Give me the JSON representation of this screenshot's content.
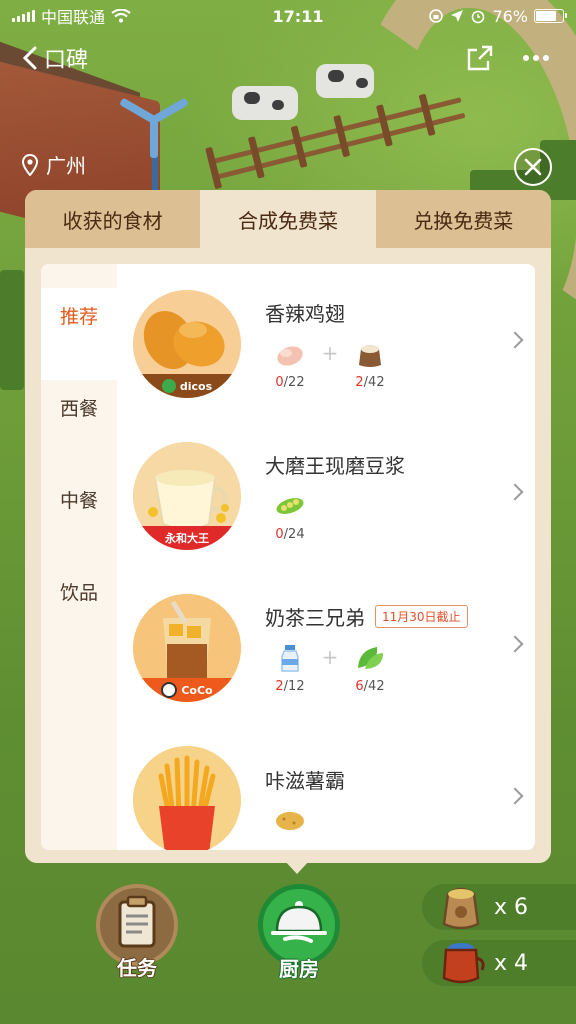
{
  "status_bar": {
    "carrier": "中国联通",
    "time": "17:11",
    "battery": "76%",
    "battery_level": 0.76
  },
  "nav": {
    "title": "口碑"
  },
  "location": "广州",
  "tabs": [
    "收获的食材",
    "合成免费菜",
    "兑换免费菜"
  ],
  "active_tab": 1,
  "categories": [
    "推荐",
    "西餐",
    "中餐",
    "饮品"
  ],
  "active_category": 0,
  "dishes": [
    {
      "name": "香辣鸡翅",
      "brand": "dicos",
      "deadline": "",
      "ingredients": [
        {
          "icon": "chicken-wing-icon",
          "have": "0",
          "need": "/22"
        },
        {
          "icon": "flour-sack-icon",
          "have": "2",
          "need": "/42"
        }
      ]
    },
    {
      "name": "大磨王现磨豆浆",
      "brand": "永和大王",
      "deadline": "",
      "ingredients": [
        {
          "icon": "soybean-pod-icon",
          "have": "0",
          "need": "/24"
        }
      ]
    },
    {
      "name": "奶茶三兄弟",
      "brand": "CoCo",
      "deadline": "11月30日截止",
      "ingredients": [
        {
          "icon": "milk-bottle-icon",
          "have": "2",
          "need": "/12"
        },
        {
          "icon": "tea-leaf-icon",
          "have": "6",
          "need": "/42"
        }
      ]
    },
    {
      "name": "咔滋薯霸",
      "brand": "",
      "deadline": "",
      "ingredients": [
        {
          "icon": "potato-icon",
          "have": "",
          "need": ""
        }
      ]
    }
  ],
  "bottom": {
    "task_label": "任务",
    "kitchen_label": "厨房",
    "inventory": [
      {
        "icon": "grain-sack-icon",
        "count": "x 6"
      },
      {
        "icon": "teapot-icon",
        "count": "x 4"
      }
    ]
  },
  "colors": {
    "accent": "#e25a1c",
    "count_red": "#e0302a",
    "tab_bg": "#ddbf94",
    "panel_bg": "#f1e4cf",
    "grass": "#6d9a3a"
  }
}
